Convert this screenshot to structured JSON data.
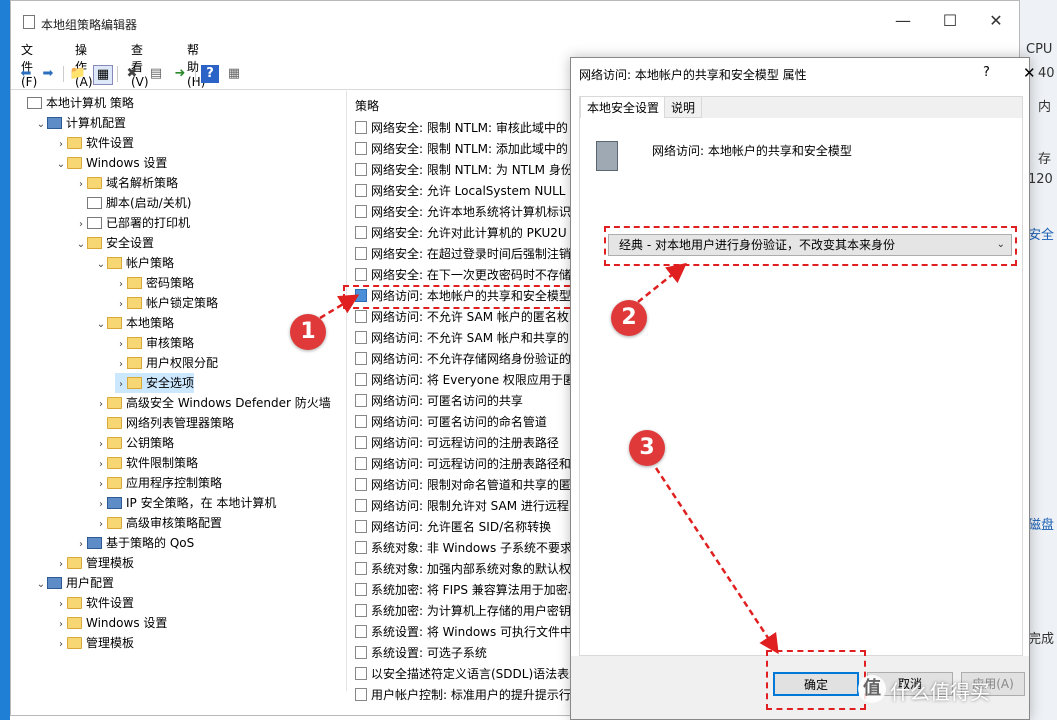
{
  "window": {
    "title": "本地组策略编辑器",
    "minimize": "—",
    "maximize": "☐",
    "close": "✕"
  },
  "menu": [
    "文件(F)",
    "操作(A)",
    "查看(V)",
    "帮助(H)"
  ],
  "toolbar": {
    "icons": [
      "back-icon",
      "forward-icon",
      "up-folder-icon",
      "show-hide-tree-icon",
      "delete-icon",
      "properties-icon",
      "export-list-icon",
      "help-icon",
      "show-hide-action-pane-icon"
    ],
    "glyphs": [
      "⬅",
      "➡",
      "📁",
      "▦",
      "✖",
      "▤",
      "➜",
      "?",
      "▦"
    ]
  },
  "tree": [
    {
      "label": "本地计算机 策略",
      "level": 0,
      "arrow": "",
      "icon": "doc"
    },
    {
      "label": "计算机配置",
      "level": 1,
      "arrow": "⌄",
      "icon": "comp"
    },
    {
      "label": "软件设置",
      "level": 2,
      "arrow": "›",
      "icon": "folder"
    },
    {
      "label": "Windows 设置",
      "level": 2,
      "arrow": "⌄",
      "icon": "folder"
    },
    {
      "label": "域名解析策略",
      "level": 3,
      "arrow": "›",
      "icon": "folder"
    },
    {
      "label": "脚本(启动/关机)",
      "level": 3,
      "arrow": "",
      "icon": "doc"
    },
    {
      "label": "已部署的打印机",
      "level": 3,
      "arrow": "›",
      "icon": "doc"
    },
    {
      "label": "安全设置",
      "level": 3,
      "arrow": "⌄",
      "icon": "lockfolder"
    },
    {
      "label": "帐户策略",
      "level": 4,
      "arrow": "⌄",
      "icon": "lockfolder"
    },
    {
      "label": "密码策略",
      "level": 5,
      "arrow": "›",
      "icon": "lockfolder"
    },
    {
      "label": "帐户锁定策略",
      "level": 5,
      "arrow": "›",
      "icon": "lockfolder"
    },
    {
      "label": "本地策略",
      "level": 4,
      "arrow": "⌄",
      "icon": "lockfolder"
    },
    {
      "label": "审核策略",
      "level": 5,
      "arrow": "›",
      "icon": "lockfolder"
    },
    {
      "label": "用户权限分配",
      "level": 5,
      "arrow": "›",
      "icon": "lockfolder"
    },
    {
      "label": "安全选项",
      "level": 5,
      "arrow": "›",
      "icon": "lockfolder",
      "selected": true
    },
    {
      "label": "高级安全 Windows Defender 防火墙",
      "level": 4,
      "arrow": "›",
      "icon": "folder"
    },
    {
      "label": "网络列表管理器策略",
      "level": 4,
      "arrow": "",
      "icon": "folder"
    },
    {
      "label": "公钥策略",
      "level": 4,
      "arrow": "›",
      "icon": "folder"
    },
    {
      "label": "软件限制策略",
      "level": 4,
      "arrow": "›",
      "icon": "folder"
    },
    {
      "label": "应用程序控制策略",
      "level": 4,
      "arrow": "›",
      "icon": "folder"
    },
    {
      "label": "IP 安全策略，在 本地计算机",
      "level": 4,
      "arrow": "›",
      "icon": "comp"
    },
    {
      "label": "高级审核策略配置",
      "level": 4,
      "arrow": "›",
      "icon": "folder"
    },
    {
      "label": "基于策略的 QoS",
      "level": 3,
      "arrow": "›",
      "icon": "comp"
    },
    {
      "label": "管理模板",
      "level": 2,
      "arrow": "›",
      "icon": "folder"
    },
    {
      "label": "用户配置",
      "level": 1,
      "arrow": "⌄",
      "icon": "comp"
    },
    {
      "label": "软件设置",
      "level": 2,
      "arrow": "›",
      "icon": "folder"
    },
    {
      "label": "Windows 设置",
      "level": 2,
      "arrow": "›",
      "icon": "folder"
    },
    {
      "label": "管理模板",
      "level": 2,
      "arrow": "›",
      "icon": "folder"
    }
  ],
  "list": {
    "header": "策略",
    "rows": [
      "网络安全: 限制 NTLM: 审核此域中的",
      "网络安全: 限制 NTLM: 添加此域中的",
      "网络安全: 限制 NTLM: 为 NTLM 身份",
      "网络安全: 允许 LocalSystem NULL 会",
      "网络安全: 允许本地系统将计算机标识",
      "网络安全: 允许对此计算机的 PKU2U",
      "网络安全: 在超过登录时间后强制注销",
      "网络安全: 在下一次更改密码时不存储",
      "网络访问: 本地帐户的共享和安全模型",
      "网络访问: 不允许 SAM 帐户的匿名枚",
      "网络访问: 不允许 SAM 帐户和共享的",
      "网络访问: 不允许存储网络身份验证的",
      "网络访问: 将 Everyone 权限应用于匿",
      "网络访问: 可匿名访问的共享",
      "网络访问: 可匿名访问的命名管道",
      "网络访问: 可远程访问的注册表路径",
      "网络访问: 可远程访问的注册表路径和",
      "网络访问: 限制对命名管道和共享的匿",
      "网络访问: 限制允许对 SAM 进行远程",
      "网络访问: 允许匿名 SID/名称转换",
      "系统对象: 非 Windows 子系统不要求",
      "系统对象: 加强内部系统对象的默认权",
      "系统加密: 将 FIPS 兼容算法用于加密、",
      "系统加密: 为计算机上存储的用户密钥",
      "系统设置: 将 Windows 可执行文件中",
      "系统设置: 可选子系统",
      "以安全描述符定义语言(SDDL)语法表示",
      "用户帐户控制: 标准用户的提升提示行"
    ],
    "highlight_index": 8
  },
  "dialog": {
    "title": "网络访问: 本地帐户的共享和安全模型 属性",
    "help": "?",
    "close": "✕",
    "tabs": [
      "本地安全设置",
      "说明"
    ],
    "policy_name": "网络访问: 本地帐户的共享和安全模型",
    "combo_value": "经典 - 对本地用户进行身份验证，不改变其本来身份",
    "combo_arrow": "⌄",
    "buttons": {
      "ok": "确定",
      "cancel": "取消",
      "apply": "应用(A)"
    }
  },
  "annotations": {
    "badges": [
      "1",
      "2",
      "3"
    ],
    "color": "#e02020"
  },
  "background_right": {
    "lines": [
      "CPU",
      "40",
      "内",
      "存",
      "120",
      "安全",
      "磁盘",
      "完成"
    ]
  },
  "watermark": {
    "icon": "值",
    "text": "什么值得买"
  }
}
